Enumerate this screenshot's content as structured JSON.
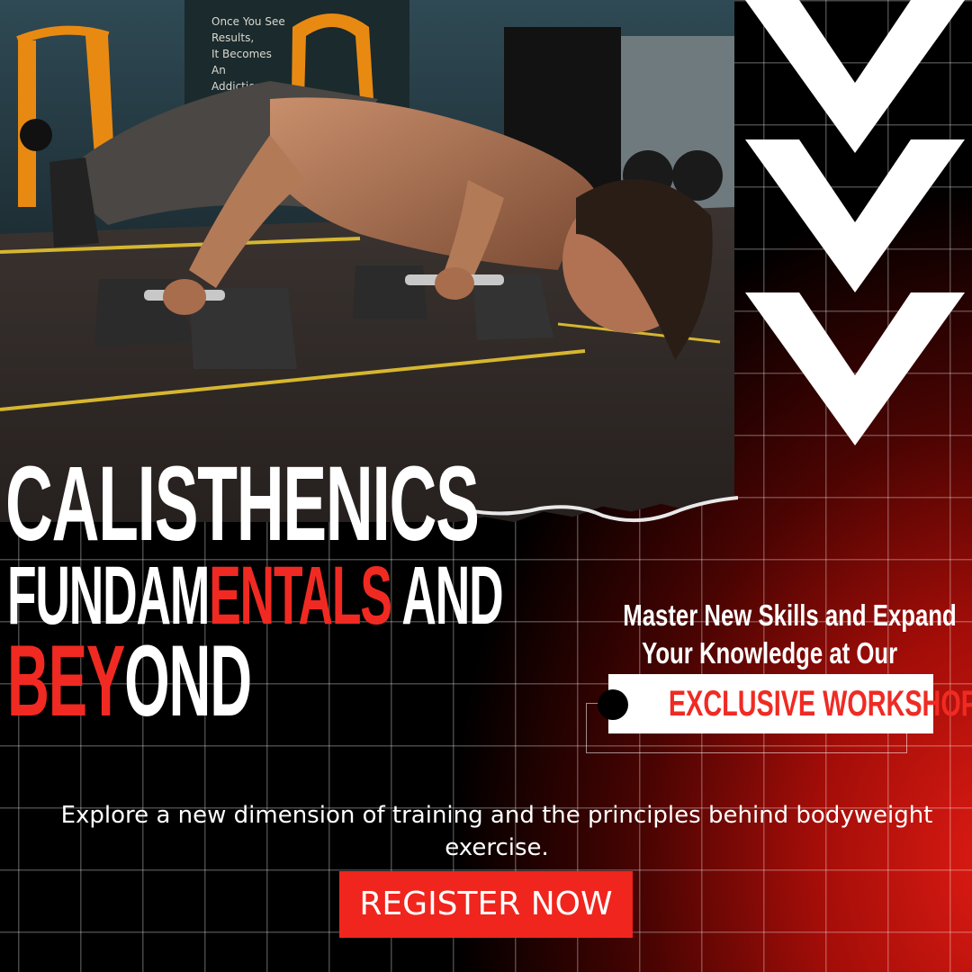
{
  "headline": {
    "line1": "CALISTHENICS",
    "line2_white": "FUNDAM",
    "line2_red": "ENTALS",
    "line2_white_end": " AND",
    "line3_red": "BEY",
    "line3_white": "OND"
  },
  "tagline": {
    "line1": "Master New Skills and Expand",
    "line2": "Your Knowledge at Our"
  },
  "badge": {
    "label": "EXCLUSIVE WORKSHOP"
  },
  "description": "Explore a new dimension of training and the principles behind bodyweight exercise.",
  "cta": {
    "label": "REGISTER NOW"
  },
  "chalkboard": {
    "line1": "Once You See",
    "line2": "Results,",
    "line3": "It Becomes",
    "line4": "An",
    "line5": "Addiction"
  },
  "icons": {
    "decor": "chevron-down-icon"
  },
  "colors": {
    "accent_red": "#f0251d",
    "background": "#000000",
    "text": "#ffffff"
  }
}
